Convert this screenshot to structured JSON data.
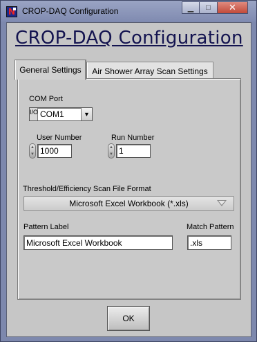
{
  "window": {
    "title": "CROP-DAQ Configuration",
    "controls": {
      "minimize": "▁",
      "maximize": "□",
      "close": "✕"
    }
  },
  "page_title": "CROP-DAQ Configuration",
  "tabs": [
    {
      "label": "General Settings",
      "active": true
    },
    {
      "label": "Air Shower Array Scan Settings",
      "active": false
    }
  ],
  "general": {
    "com_port": {
      "label": "COM Port",
      "value": "COM1",
      "io_icon": "I/O"
    },
    "user_number": {
      "label": "User Number",
      "value": "1000"
    },
    "run_number": {
      "label": "Run Number",
      "value": "1"
    },
    "scan_format": {
      "label": "Threshold/Efficiency Scan File Format",
      "value": "Microsoft Excel Workbook (*.xls)"
    },
    "pattern_label": {
      "label": "Pattern Label",
      "value": "Microsoft Excel Workbook"
    },
    "match_pattern": {
      "label": "Match Pattern",
      "value": ".xls"
    }
  },
  "ok_button": "OK"
}
